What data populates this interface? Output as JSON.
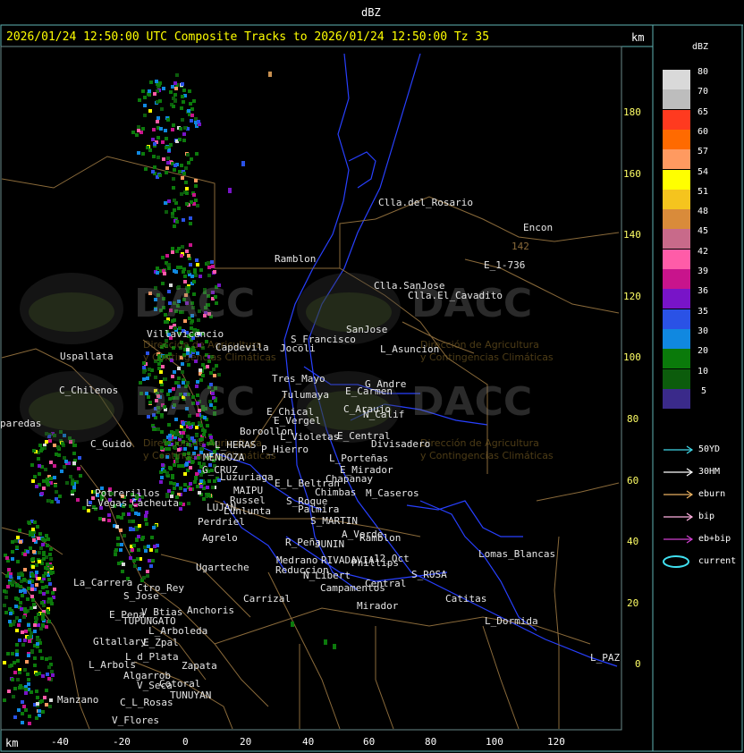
{
  "header": {
    "title": "dBZ"
  },
  "plot": {
    "title": "2026/01/24 12:50:00 UTC Composite Tracks to 2026/01/24 12:50:00 Tz 35",
    "unit_top": "km",
    "unit_bottom": "km"
  },
  "watermark": {
    "brand": "DACC",
    "line1": "Dirección de Agricultura",
    "line2": "y Contingencias Climáticas"
  },
  "x_ticks": [
    "-40",
    "-20",
    "0",
    "20",
    "40",
    "60",
    "80",
    "100",
    "120"
  ],
  "y_ticks": [
    "180",
    "160",
    "140",
    "120",
    "100",
    "80",
    "60",
    "40",
    "20",
    "0"
  ],
  "places": [
    "Clla.del_Rosario",
    "Encon",
    "142",
    "E_1-736",
    "Ramblon",
    "Clla.SanJose",
    "Clla.El_Cavadito",
    "Villavicencio",
    "Uspallata",
    "Capdevila",
    "S_Francisco",
    "SanJose",
    "L_Asuncion",
    "Jocoli",
    "C_Chilenos",
    "Tres_Mayo",
    "G_Andre",
    "Tulumaya",
    "E_Carmen",
    "C_Araujo",
    "N_Calif",
    "E_Chical",
    "E_Vergel",
    "Boroollon",
    "L_Violetas",
    "E_Central",
    "Divisadero",
    "paredas",
    "C_Guido",
    "P_Hierro",
    "L_HERAS",
    "MENDOZA",
    "L_Porteñas",
    "Chapanay",
    "E_Mirador",
    "G_CRUZ",
    "Luzuriaga",
    "E_L_Beltran",
    "MAIPU",
    "Potrerillos",
    "S_Roque",
    "Chimbas",
    "M_Caseros",
    "L_Vegas",
    "Cacheuta",
    "Russel",
    "LUJAN",
    "Lunlunta",
    "Palmira",
    "S_MARTIN",
    "Perdriel",
    "A_Verde",
    "Ramblon",
    "Agrelo",
    "R_Peña",
    "JUNIN",
    "Lomas_Blancas",
    "Medrano",
    "Ugarteche",
    "RIVADAVIA",
    "Phillips",
    "Reduccion",
    "12_Oct",
    "Ctro_Rey",
    "La_Carrera",
    "N_Libert",
    "S_ROSA",
    "S_Jose",
    "Campamentos",
    "Central",
    "Catitas",
    "Carrizal",
    "E_Pena",
    "Anchoris",
    "V_Btias",
    "Mirador",
    "TUPUNGATO",
    "L_Dormida",
    "L_Arboleda",
    "Gltallary",
    "E_Zpal",
    "L_d_Plata",
    "Zapata",
    "L_PAZ",
    "L_Arbols",
    "Algarrob",
    "V_Seca",
    "Cotoral",
    "Manzano",
    "TUNUYAN",
    "C_L_Rosas",
    "V_Flores"
  ],
  "legend": {
    "title": "dBZ",
    "levels": [
      {
        "label": "80",
        "color": "#d9d9d9"
      },
      {
        "label": "70",
        "color": "#bdbdbd"
      },
      {
        "label": "65",
        "color": "#ff3a1f"
      },
      {
        "label": "60",
        "color": "#ff6a00"
      },
      {
        "label": "57",
        "color": "#ff9a60"
      },
      {
        "label": "54",
        "color": "#ffff00"
      },
      {
        "label": "51",
        "color": "#f5c41e"
      },
      {
        "label": "48",
        "color": "#d98b3a"
      },
      {
        "label": "45",
        "color": "#c86a8a"
      },
      {
        "label": "42",
        "color": "#ff5ca8"
      },
      {
        "label": "39",
        "color": "#c8148c"
      },
      {
        "label": "36",
        "color": "#7814c8"
      },
      {
        "label": "35",
        "color": "#2a52e6"
      },
      {
        "label": "30",
        "color": "#1088e0"
      },
      {
        "label": "20",
        "color": "#0a7a0a"
      },
      {
        "label": "10",
        "color": "#0c5c0c"
      },
      {
        "label": "5",
        "color": "#3a2a8a"
      }
    ],
    "tracks": [
      {
        "label": "50YD",
        "color": "#40d8e8"
      },
      {
        "label": "30HM",
        "color": "#ffffff"
      },
      {
        "label": "eburn",
        "color": "#e8b060"
      },
      {
        "label": "bip",
        "color": "#ffb0e0"
      },
      {
        "label": "eb+bip",
        "color": "#d040d0"
      },
      {
        "label": "current",
        "color": "#40e0f0"
      }
    ]
  }
}
